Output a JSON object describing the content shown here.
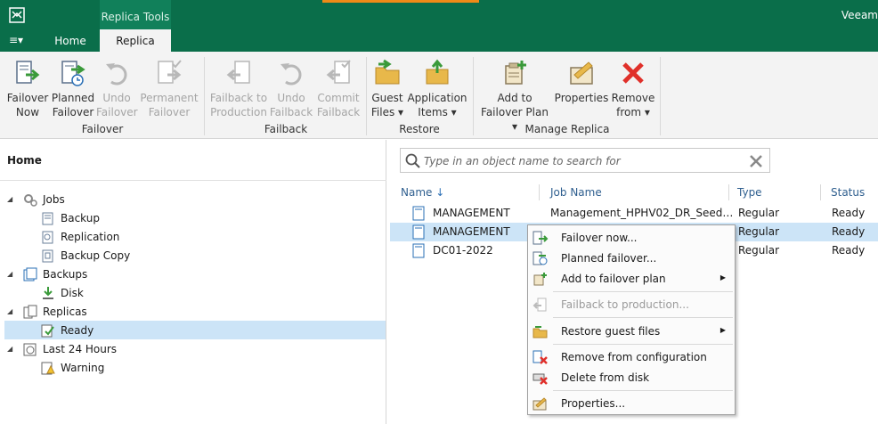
{
  "title_bar": {
    "context_tab_header": "Replica Tools",
    "brand": "Veeam"
  },
  "tabs": {
    "menu": "≡▾",
    "home": "Home",
    "replica": "Replica"
  },
  "ribbon": {
    "failover": {
      "group_label": "Failover",
      "failover_now": [
        "Failover",
        "Now"
      ],
      "planned_failover": [
        "Planned",
        "Failover"
      ],
      "undo_failover": [
        "Undo",
        "Failover"
      ],
      "permanent_failover": [
        "Permanent",
        "Failover"
      ]
    },
    "failback": {
      "group_label": "Failback",
      "failback_to_production": [
        "Failback to",
        "Production"
      ],
      "undo_failback": [
        "Undo",
        "Failback"
      ],
      "commit_failback": [
        "Commit",
        "Failback"
      ]
    },
    "restore": {
      "group_label": "Restore",
      "guest_files": [
        "Guest",
        "Files ▾"
      ],
      "application_items": [
        "Application",
        "Items ▾"
      ]
    },
    "manage_replica": {
      "group_label": "Manage Replica",
      "add_to_failover_plan": [
        "Add to",
        "Failover Plan ▾"
      ],
      "properties": [
        "Properties",
        ""
      ],
      "remove_from": [
        "Remove",
        "from ▾"
      ]
    }
  },
  "left_pane": {
    "title": "Home",
    "tree": {
      "jobs": "Jobs",
      "backup": "Backup",
      "replication": "Replication",
      "backup_copy": "Backup Copy",
      "backups": "Backups",
      "disk": "Disk",
      "replicas": "Replicas",
      "ready": "Ready",
      "last24": "Last 24 Hours",
      "warning": "Warning"
    }
  },
  "search": {
    "placeholder": "Type in an object name to search for"
  },
  "columns": {
    "name": "Name",
    "sort_icon": "↓",
    "job_name": "Job Name",
    "type": "Type",
    "status": "Status"
  },
  "rows": [
    {
      "name": "MANAGEMENT",
      "job_name": "Management_HPHV02_DR_Seed…",
      "type": "Regular",
      "status": "Ready"
    },
    {
      "name": "MANAGEMENT",
      "job_name": "",
      "type": "Regular",
      "status": "Ready"
    },
    {
      "name": "DC01-2022",
      "job_name": "",
      "type": "Regular",
      "status": "Ready"
    }
  ],
  "context_menu": {
    "failover_now": "Failover now...",
    "planned_failover": "Planned failover...",
    "add_to_failover_plan": "Add to failover plan",
    "failback_to_production": "Failback to production...",
    "restore_guest_files": "Restore guest files",
    "remove_from_configuration": "Remove from configuration",
    "delete_from_disk": "Delete from disk",
    "properties": "Properties...",
    "submenu_arrow": "▶"
  },
  "colors": {
    "brand_green": "#0a6e4a",
    "selection": "#cce4f7",
    "accent_orange": "#ef8a17"
  }
}
